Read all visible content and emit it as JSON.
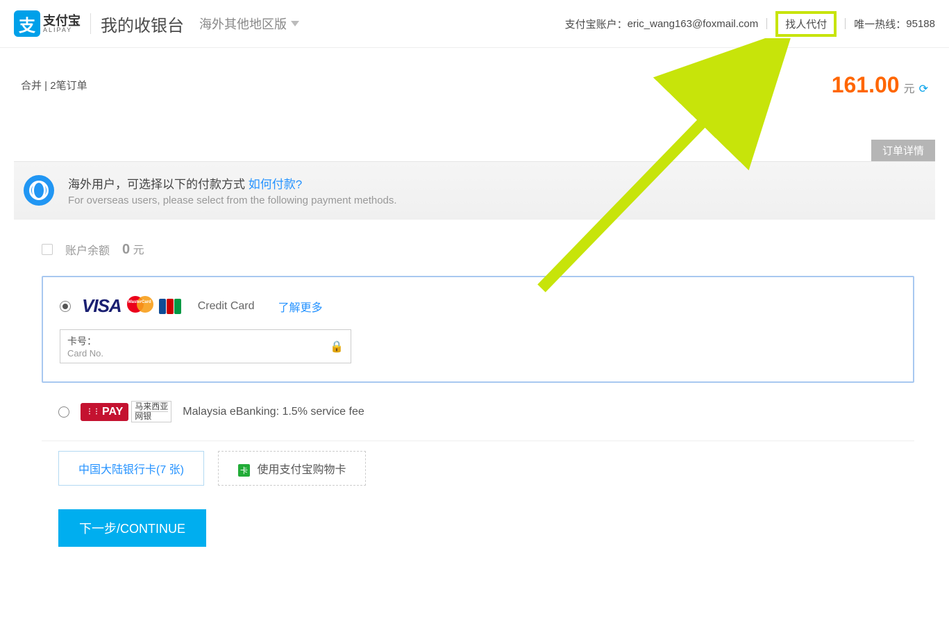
{
  "header": {
    "logo_cn": "支付宝",
    "logo_en": "ALIPAY",
    "title": "我的收银台",
    "region": "海外其他地区版",
    "account_label": "支付宝账户：",
    "account_email": "eric_wang163@foxmail.com",
    "pay_for_me": "找人代付",
    "hotline_label": "唯一热线：",
    "hotline_number": "95188"
  },
  "order": {
    "merged_label": "合并 | 2笔订单",
    "amount": "161.00",
    "currency": "元",
    "detail_tab": "订单详情"
  },
  "overseas": {
    "line1_cn": "海外用户，可选择以下的付款方式 ",
    "link": "如何付款?",
    "line2_en": "For overseas users, please select from the following payment methods."
  },
  "balance": {
    "label": "账户余额",
    "value": "0",
    "unit": "元"
  },
  "credit_card": {
    "label": "Credit Card",
    "more": "了解更多",
    "card_label_cn": "卡号：",
    "card_label_en": "Card No."
  },
  "ebanking": {
    "badge": "PAY",
    "cn1": "马来西亚",
    "cn2": "网银",
    "label": "Malaysia eBanking: 1.5% service fee"
  },
  "alt": {
    "mainland": "中国大陆银行卡(7 张)",
    "shopcard": "使用支付宝购物卡",
    "badge": "卡"
  },
  "continue_btn": "下一步/CONTINUE"
}
